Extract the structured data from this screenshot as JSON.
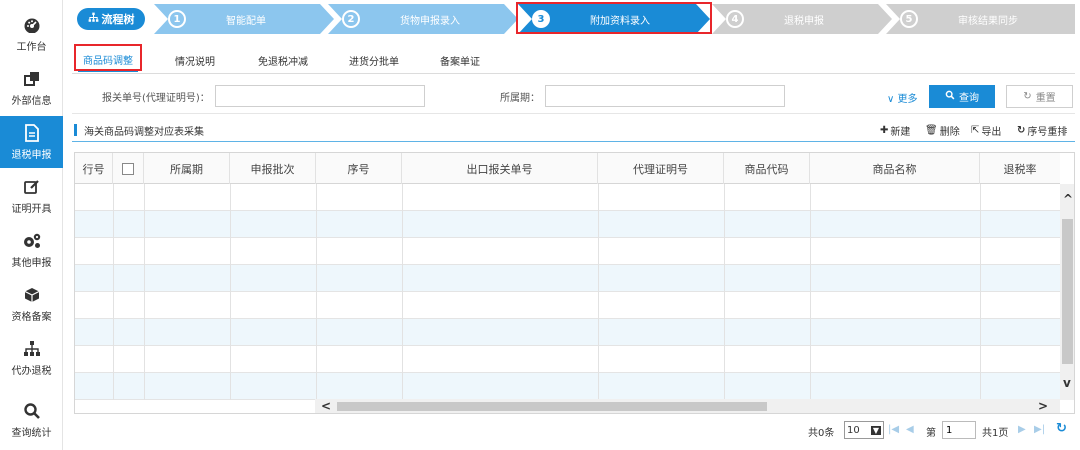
{
  "sidebar": {
    "items": [
      {
        "label": "工作台",
        "icon": "dashboard-icon"
      },
      {
        "label": "外部信息",
        "icon": "external-link-icon"
      },
      {
        "label": "退税申报",
        "icon": "document-icon"
      },
      {
        "label": "证明开具",
        "icon": "edit-icon"
      },
      {
        "label": "其他申报",
        "icon": "gears-icon"
      },
      {
        "label": "资格备案",
        "icon": "box-icon"
      },
      {
        "label": "代办退税",
        "icon": "org-chart-icon"
      },
      {
        "label": "查询统计",
        "icon": "search-icon"
      }
    ]
  },
  "steps": {
    "tree_label": "流程树",
    "items": [
      {
        "num": "1",
        "label": "智能配单"
      },
      {
        "num": "2",
        "label": "货物申报录入"
      },
      {
        "num": "3",
        "label": "附加资料录入"
      },
      {
        "num": "4",
        "label": "退税申报"
      },
      {
        "num": "5",
        "label": "审核结果同步"
      }
    ]
  },
  "subtabs": [
    "商品码调整",
    "情况说明",
    "免退税冲减",
    "进货分批单",
    "备案单证"
  ],
  "filter": {
    "customs_label": "报关单号(代理证明号)：",
    "customs_value": "",
    "period_label": "所属期：",
    "period_value": "",
    "more_label": "更多",
    "query_label": "查询",
    "reset_label": "重置"
  },
  "section": {
    "title": "海关商品码调整对应表采集",
    "new_label": "新建",
    "delete_label": "删除",
    "export_label": "导出",
    "reorder_label": "序号重排"
  },
  "table": {
    "columns": [
      "行号",
      "",
      "所属期",
      "申报批次",
      "序号",
      "出口报关单号",
      "代理证明号",
      "商品代码",
      "商品名称",
      "退税率"
    ],
    "rows": [
      [],
      [],
      [],
      [],
      [],
      [],
      [],
      []
    ]
  },
  "pager": {
    "total": "共0条",
    "page_size": "10",
    "page_label": "第",
    "page_value": "1",
    "pages": "共1页"
  }
}
